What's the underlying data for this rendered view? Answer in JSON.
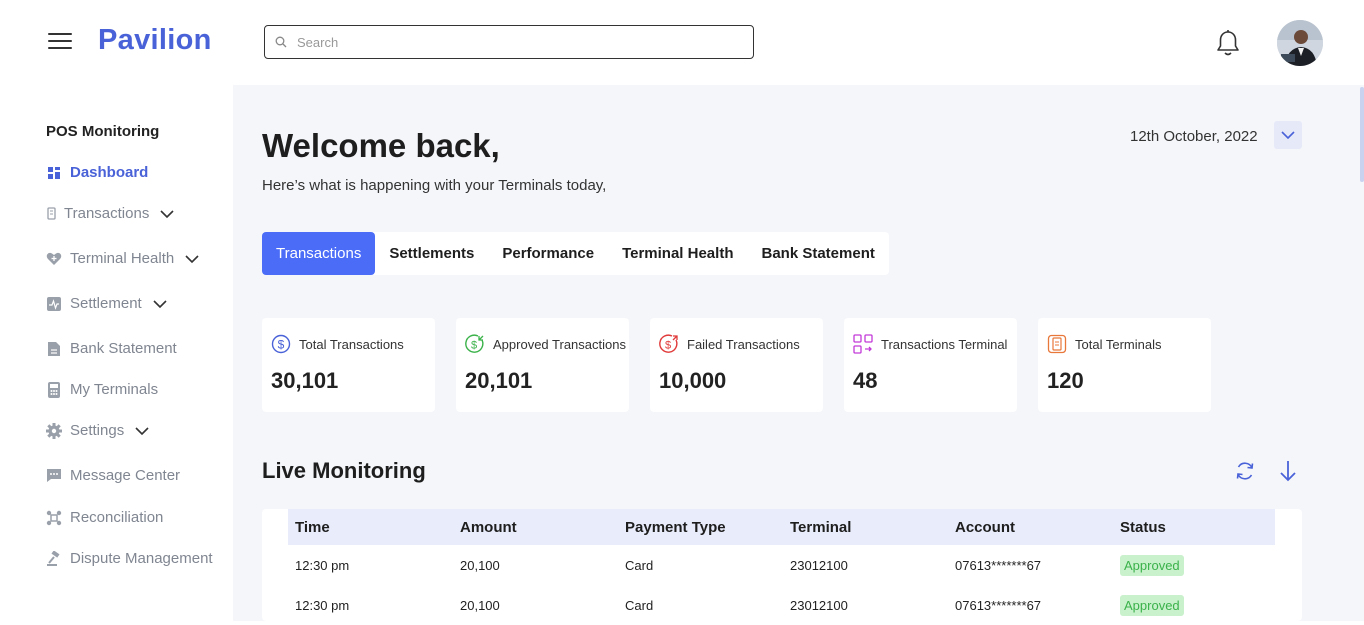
{
  "header": {
    "logo": "Pavilion",
    "search_placeholder": "Search"
  },
  "sidebar": {
    "heading": "POS Monitoring",
    "items": [
      {
        "label": "Dashboard",
        "icon": "dashboard-icon"
      },
      {
        "label": "Transactions",
        "icon": "receipt-icon"
      },
      {
        "label": "Terminal Health",
        "icon": "heart-icon"
      },
      {
        "label": "Settlement",
        "icon": "settlement-icon"
      },
      {
        "label": "Bank Statement",
        "icon": "document-icon"
      },
      {
        "label": "My Terminals",
        "icon": "terminal-icon"
      },
      {
        "label": "Settings",
        "icon": "gear-icon"
      },
      {
        "label": "Message Center",
        "icon": "message-icon"
      },
      {
        "label": "Reconciliation",
        "icon": "reconcile-icon"
      },
      {
        "label": "Dispute Management",
        "icon": "gavel-icon"
      }
    ]
  },
  "main": {
    "welcome": "Welcome back,",
    "subtitle": "Here’s what is happening with your Terminals today,",
    "date": "12th October, 2022",
    "tabs": [
      "Transactions",
      "Settlements",
      "Performance",
      "Terminal Health",
      "Bank Statement"
    ],
    "cards": [
      {
        "label": "Total Transactions",
        "value": "30,101",
        "color": "#4a62d8"
      },
      {
        "label": "Approved Transactions",
        "value": "20,101",
        "color": "#3bb24a"
      },
      {
        "label": "Failed Transactions",
        "value": "10,000",
        "color": "#e03a3a"
      },
      {
        "label": "Transactions Terminal",
        "value": "48",
        "color": "#c23ad8"
      },
      {
        "label": "Total Terminals",
        "value": "120",
        "color": "#e8773a"
      }
    ],
    "live_title": "Live Monitoring",
    "table": {
      "headers": [
        "Time",
        "Amount",
        "Payment Type",
        "Terminal",
        "Account",
        "Status"
      ],
      "rows": [
        [
          "12:30 pm",
          "20,100",
          "Card",
          "23012100",
          "07613*******67",
          "Approved"
        ],
        [
          "12:30 pm",
          "20,100",
          "Card",
          "23012100",
          "07613*******67",
          "Approved"
        ]
      ]
    }
  },
  "colors": {
    "accent": "#4a6cf7",
    "approved_bg": "#c9f1cc",
    "approved_text": "#3bb24a"
  }
}
